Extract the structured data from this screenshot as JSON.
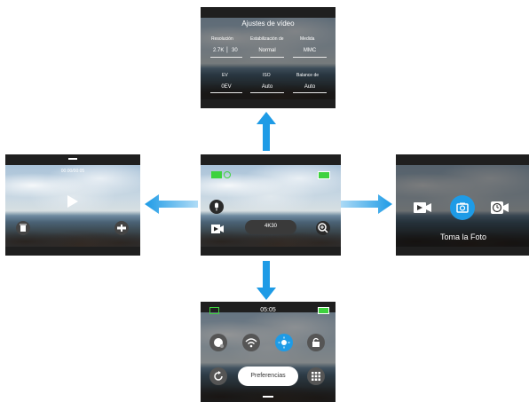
{
  "colors": {
    "accent": "#1e9be6",
    "arrow": "#1e9be6",
    "battery": "#3ed23e"
  },
  "top_screen": {
    "title": "Ajustes de vídeo",
    "settings": [
      {
        "label": "Resolución",
        "value_a": "2.7K",
        "value_b": "30"
      },
      {
        "label": "Estabilización de",
        "value": "Normal"
      },
      {
        "label": "Medida",
        "value": "MMC"
      },
      {
        "label": "EV",
        "value": "0EV"
      },
      {
        "label": "ISO",
        "value": "Auto"
      },
      {
        "label": "Balance de",
        "value": "Auto"
      }
    ]
  },
  "left_screen": {
    "timecode": "00:00/00:05"
  },
  "center_screen": {
    "resolution_badge": "4K30"
  },
  "right_screen": {
    "mode_label": "Toma la Foto"
  },
  "bottom_screen": {
    "time": "05:05",
    "preferences_label": "Preferencias"
  },
  "icons": [
    "microphone-icon",
    "video-mode-icon",
    "zoom-icon",
    "play-icon",
    "trash-icon",
    "video-camera-icon",
    "photo-camera-icon",
    "timelapse-icon",
    "voice-icon",
    "wifi-icon",
    "brightness-icon",
    "lock-icon",
    "rotate-icon",
    "grid-icon",
    "battery-icon"
  ]
}
